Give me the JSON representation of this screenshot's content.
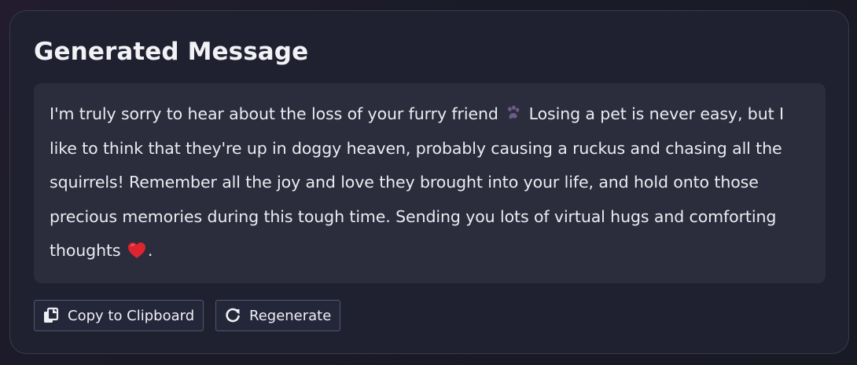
{
  "card": {
    "title": "Generated Message"
  },
  "message": {
    "part1": "I'm truly sorry to hear about the loss of your furry friend ",
    "paw_emoji": "paw-prints-icon",
    "part2": " Losing a pet is never easy, but I like to think that they're up in doggy heaven, probably causing a ruckus and chasing all the squirrels! Remember all the joy and love they brought into your life, and hold onto those precious memories during this tough time. Sending you lots of virtual hugs and comforting thoughts ",
    "heart_emoji": "red-heart-icon",
    "part3": "."
  },
  "actions": {
    "copy_label": "Copy to Clipboard",
    "copy_icon": "copy-icon",
    "regenerate_label": "Regenerate",
    "regenerate_icon": "refresh-icon"
  },
  "colors": {
    "background": "#1b1b28",
    "card": "#1f2130",
    "message_box": "#2b2d3c",
    "text": "#ecebf2",
    "button_border": "#55576a"
  }
}
